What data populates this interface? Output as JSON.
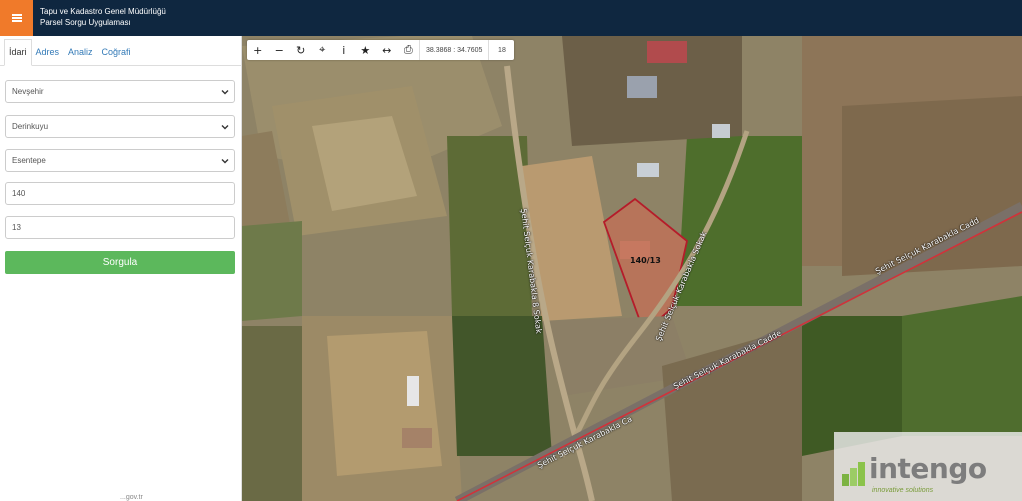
{
  "header": {
    "title_line1": "Tapu ve Kadastro Genel Müdürlüğü",
    "title_line2": "Parsel Sorgu Uygulaması",
    "menu_icon": "hamburger-icon",
    "accent_color": "#f07a2a",
    "bar_color": "#0f2740"
  },
  "sidebar": {
    "tabs": [
      {
        "label": "İdari",
        "active": true
      },
      {
        "label": "Adres"
      },
      {
        "label": "Analiz"
      },
      {
        "label": "Coğrafi"
      }
    ],
    "province": "Nevşehir",
    "district": "Derinkuyu",
    "neighborhood": "Esentepe",
    "block": "140",
    "parcel": "13",
    "query_button": "Sorgula",
    "query_button_color": "#5cb85c",
    "footer_text": "...gov.tr"
  },
  "map": {
    "toolbar": {
      "icons": [
        "zoom-in-icon",
        "zoom-out-icon",
        "refresh-icon",
        "locate-icon",
        "info-icon",
        "favorite-star-icon",
        "measure-icon",
        "print-icon"
      ],
      "coordinates": "38.3868 : 34.7605",
      "zoom_level": "18"
    },
    "parcel_label": "140/13",
    "streets": {
      "vertical": "Şehit Selçuk Karabakla 8 Sokak",
      "diag_upper": "Şehit Selçuk Karabakla Sokak",
      "main_right": "Şehit Selçuk Karabakla Cadd",
      "main_mid": "Şehit Selçuk Karabakla Cadde",
      "main_left": "Şehit Selçuk Karabakla Ca"
    },
    "watermark": {
      "brand": "intengo",
      "tagline": "innovative solutions"
    }
  }
}
